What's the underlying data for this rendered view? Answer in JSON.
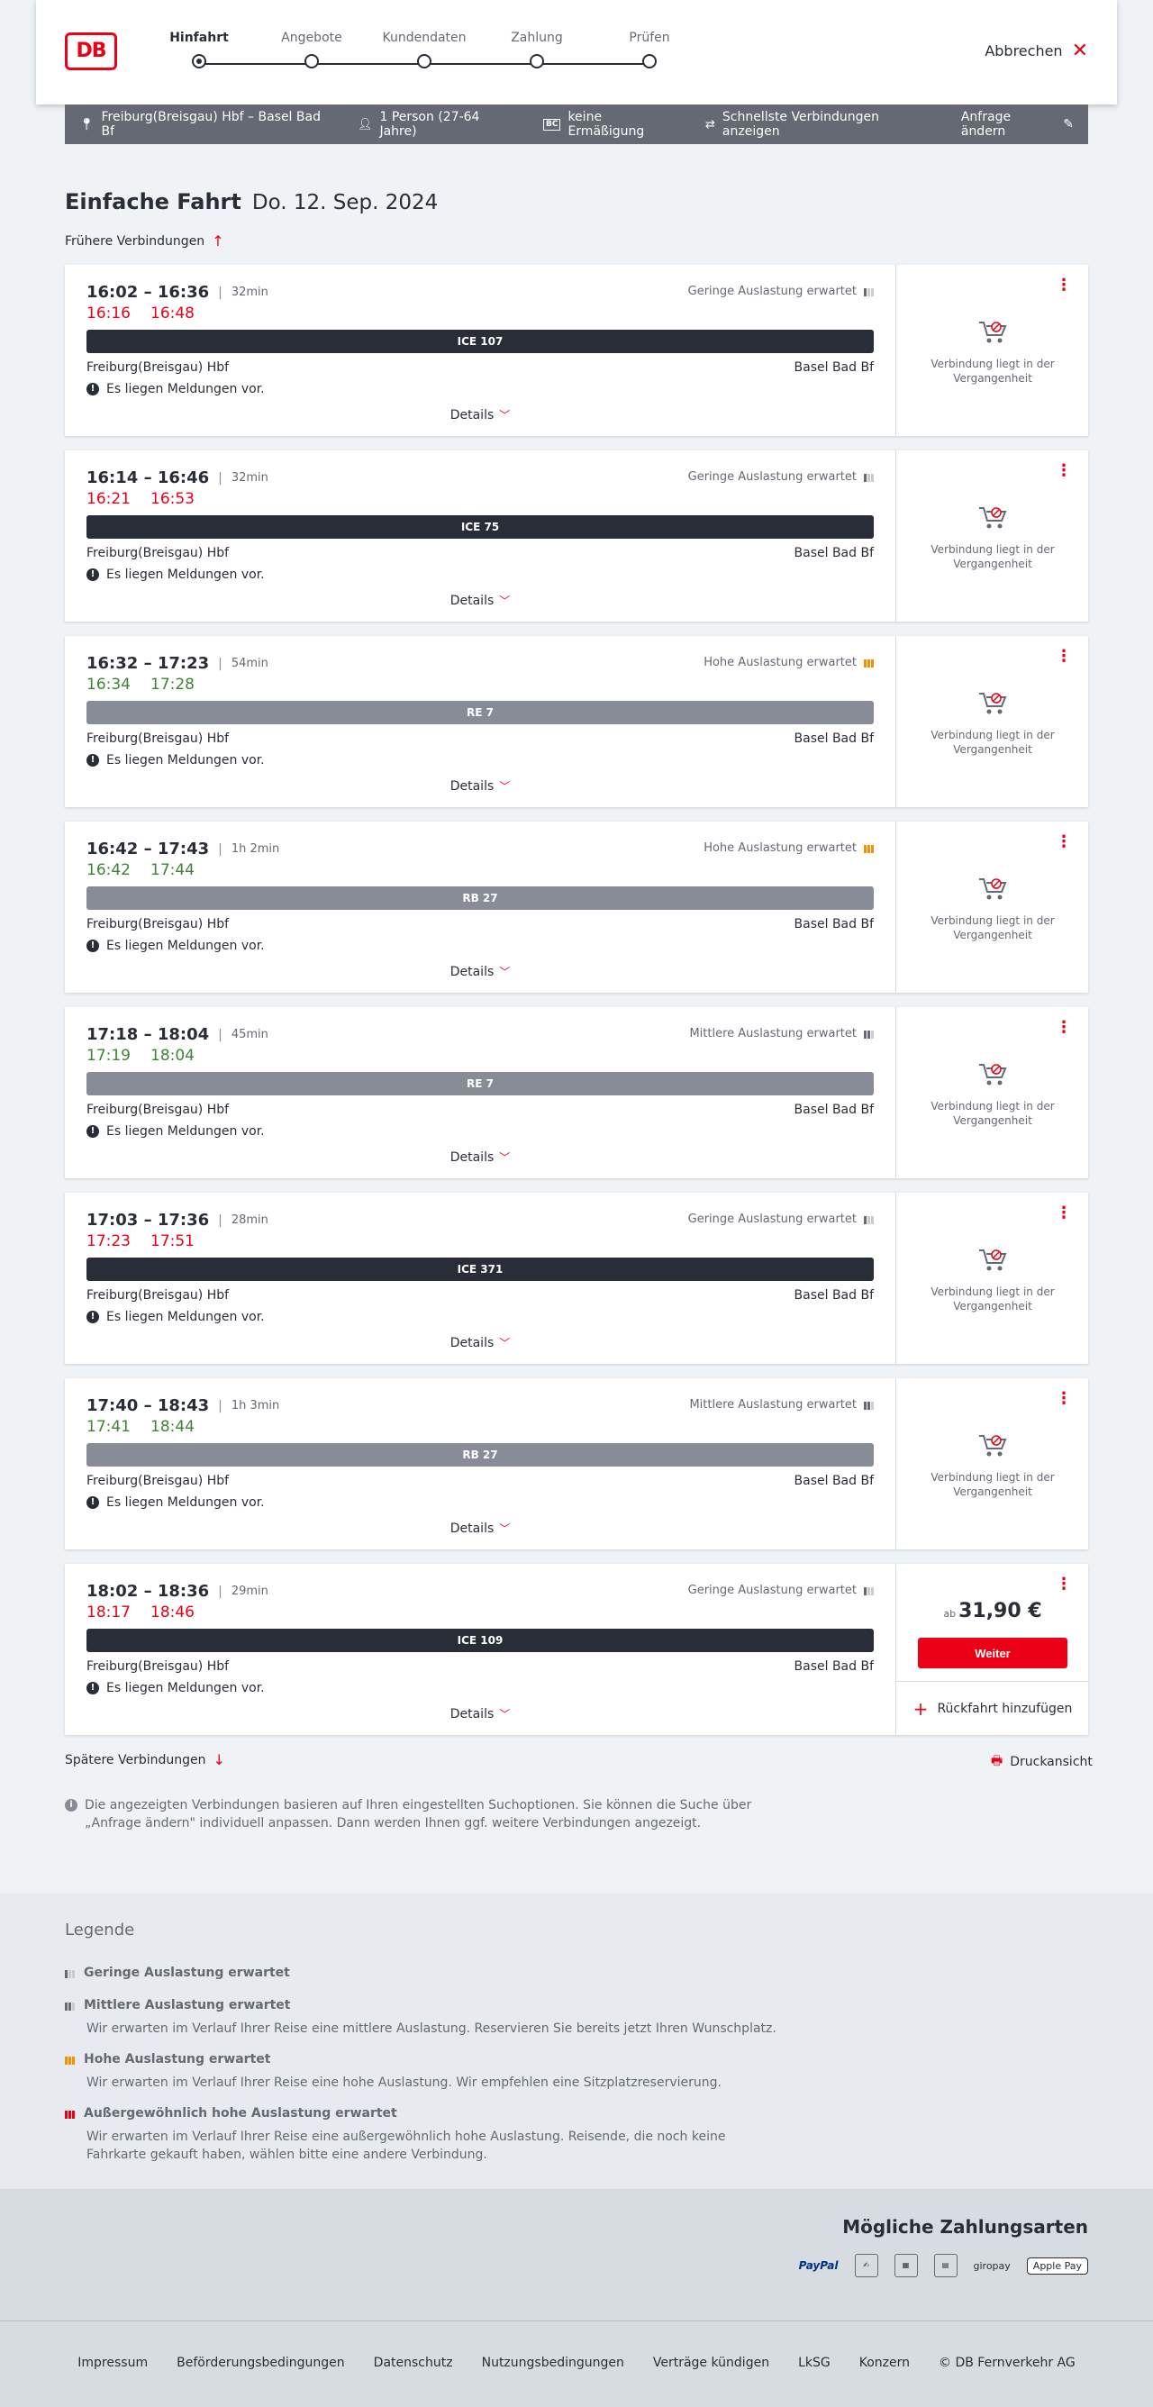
{
  "header": {
    "logo": "DB",
    "steps": [
      "Hinfahrt",
      "Angebote",
      "Kundendaten",
      "Zahlung",
      "Prüfen"
    ],
    "active_step": 0,
    "cancel_label": "Abbrechen"
  },
  "search": {
    "route": "Freiburg(Breisgau) Hbf – Basel Bad Bf",
    "passengers": "1 Person (27-64 Jahre)",
    "discount_badge": "BC",
    "discount": "keine Ermäßigung",
    "fastest": "Schnellste Verbindungen anzeigen",
    "change_label": "Anfrage ändern"
  },
  "page": {
    "title": "Einfache Fahrt",
    "date": "Do. 12. Sep. 2024",
    "earlier_label": "Frühere Verbindungen",
    "later_label": "Spätere Verbindungen",
    "print_label": "Druckansicht",
    "info_text": "Die angezeigten Verbindungen basieren auf Ihren eingestellten Suchoptionen. Sie können die Suche über „Anfrage ändern\" individuell anpassen. Dann werden Ihnen ggf. weitere Verbindungen angezeigt."
  },
  "common": {
    "from": "Freiburg(Breisgau) Hbf",
    "to": "Basel Bad Bf",
    "notice": "Es liegen Meldungen vor.",
    "details": "Details",
    "past_text": "Verbindung liegt in der Vergangenheit",
    "price_prefix": "ab",
    "continue_label": "Weiter",
    "return_label": "Rückfahrt hinzufügen"
  },
  "connections": [
    {
      "times": "16:02 – 16:36",
      "duration": "32min",
      "rt_dep": "16:16",
      "rt_arr": "16:48",
      "rt_status": "late",
      "train": "ICE 107",
      "train_type": "ice",
      "occupancy": "Geringe Auslastung erwartet",
      "occ_level": "low",
      "from": "Freiburg(Breisgau) Hbf",
      "past": true
    },
    {
      "times": "16:14 – 16:46",
      "duration": "32min",
      "rt_dep": "16:21",
      "rt_arr": "16:53",
      "rt_status": "late",
      "train": "ICE 75",
      "train_type": "ice",
      "occupancy": "Geringe Auslastung erwartet",
      "occ_level": "low",
      "from": "Freiburg(Breisgau) Hbf",
      "past": true
    },
    {
      "times": "16:32 – 17:23",
      "duration": "54min",
      "rt_dep": "16:34",
      "rt_arr": "17:28",
      "rt_status": "ontime",
      "train": "RE 7",
      "train_type": "reg",
      "occupancy": "Hohe Auslastung erwartet",
      "occ_level": "high",
      "from": "Freiburg(Breisgau) Hbf",
      "past": true
    },
    {
      "times": "16:42 – 17:43",
      "duration": "1h 2min",
      "rt_dep": "16:42",
      "rt_arr": "17:44",
      "rt_status": "ontime",
      "train": "RB 27",
      "train_type": "reg",
      "occupancy": "Hohe Auslastung erwartet",
      "occ_level": "high",
      "from": "Freiburg(Breisgau) Hbf",
      "past": true
    },
    {
      "times": "17:18 – 18:04",
      "duration": "45min",
      "rt_dep": "17:19",
      "rt_arr": "18:04",
      "rt_status": "ontime",
      "train": "RE 7",
      "train_type": "reg",
      "occupancy": "Mittlere Auslastung erwartet",
      "occ_level": "mid",
      "from": "Freiburg(Breisgau) Hbf",
      "past": true
    },
    {
      "times": "17:03 – 17:36",
      "duration": "28min",
      "rt_dep": "17:23",
      "rt_arr": "17:51",
      "rt_status": "late",
      "train": "ICE 371",
      "train_type": "ice",
      "occupancy": "Geringe Auslastung erwartet",
      "occ_level": "low",
      "from": "Freiburg(Breisgau) Hbf",
      "past": true
    },
    {
      "times": "17:40 – 18:43",
      "duration": "1h 3min",
      "rt_dep": "17:41",
      "rt_arr": "18:44",
      "rt_status": "ontime",
      "train": "RB 27",
      "train_type": "reg",
      "occupancy": "Mittlere Auslastung erwartet",
      "occ_level": "mid",
      "from": "Freiburg(Breisgau) Hbf",
      "past": true
    },
    {
      "times": "18:02 – 18:36",
      "duration": "29min",
      "rt_dep": "18:17",
      "rt_arr": "18:46",
      "rt_status": "late",
      "train": "ICE 109",
      "train_type": "ice",
      "occupancy": "Geringe Auslastung erwartet",
      "occ_level": "low",
      "from": "Freiburg(Breisgau) Hbf",
      "past": false,
      "price": "31,90 €"
    }
  ],
  "legend": {
    "title": "Legende",
    "items": [
      {
        "title": "Geringe Auslastung erwartet",
        "desc": ""
      },
      {
        "title": "Mittlere Auslastung erwartet",
        "desc": "Wir erwarten im Verlauf Ihrer Reise eine mittlere Auslastung. Reservieren Sie bereits jetzt Ihren Wunschplatz."
      },
      {
        "title": "Hohe Auslastung erwartet",
        "desc": "Wir erwarten im Verlauf Ihrer Reise eine hohe Auslastung. Wir empfehlen eine Sitzplatzreservierung."
      },
      {
        "title": "Außergewöhnlich hohe Auslastung erwartet",
        "desc": "Wir erwarten im Verlauf Ihrer Reise eine außergewöhnlich hohe Auslastung. Reisende, die noch keine Fahrkarte gekauft haben, wählen bitte eine andere Verbindung."
      }
    ]
  },
  "payment": {
    "title": "Mögliche Zahlungsarten",
    "methods": [
      "PayPal",
      "giropay",
      "Apple Pay"
    ]
  },
  "footer": {
    "links": [
      "Impressum",
      "Beförderungsbedingungen",
      "Datenschutz",
      "Nutzungsbedingungen",
      "Verträge kündigen",
      "LkSG",
      "Konzern",
      "© DB Fernverkehr AG"
    ]
  },
  "colors": {
    "accent": "#ec0016",
    "late": "#ec0016",
    "ontime": "#408335",
    "ice": "#282d37",
    "regional": "#878c96",
    "bar": "#646973"
  }
}
